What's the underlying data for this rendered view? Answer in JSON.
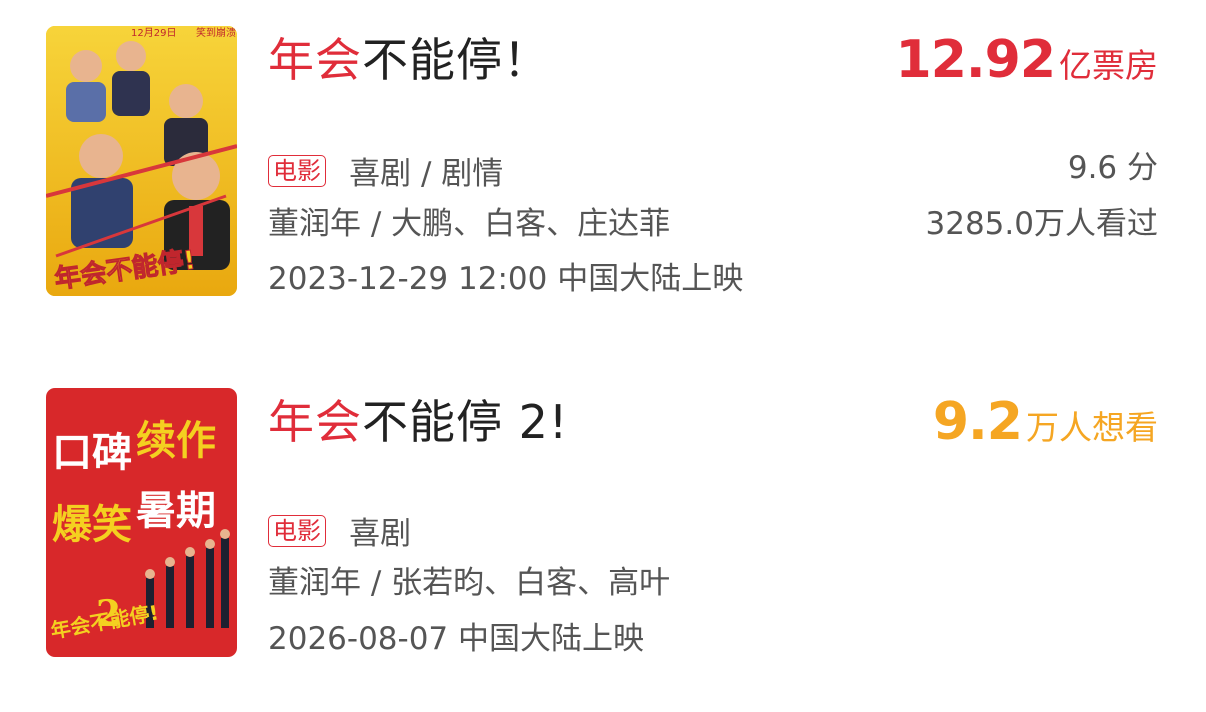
{
  "items": [
    {
      "title_highlight": "年会",
      "title_rest": "不能停！",
      "stat_value": "12.92",
      "stat_unit": "亿票房",
      "tag": "电影",
      "genres": "喜剧 / 剧情",
      "cast": "董润年 / 大鹏、白客、庄达菲",
      "release": "2023-12-29 12:00 中国大陆上映",
      "score": "9.6 分",
      "viewers": "3285.0万人看过",
      "poster": {
        "date_text": "12月29日",
        "tagline": "笑到崩溃",
        "logo_text": "年会不能停!"
      },
      "colors": {
        "stat": "#e02d3a"
      }
    },
    {
      "title_highlight": "年会",
      "title_rest": "不能停 2!",
      "stat_value": "9.2",
      "stat_unit": "万人想看",
      "tag": "电影",
      "genres": "喜剧",
      "cast": "董润年 / 张若昀、白客、高叶",
      "release": "2026-08-07 中国大陆上映",
      "poster": {
        "line1_a": "口碑",
        "line1_b": "续作",
        "line2_a": "爆笑",
        "line2_b": "暑期",
        "logo_text": "年会不能停!",
        "logo_number": "2"
      },
      "colors": {
        "stat": "#f5a623"
      }
    }
  ],
  "colors": {
    "accent": "#e02d3a",
    "orange": "#f5a623"
  }
}
